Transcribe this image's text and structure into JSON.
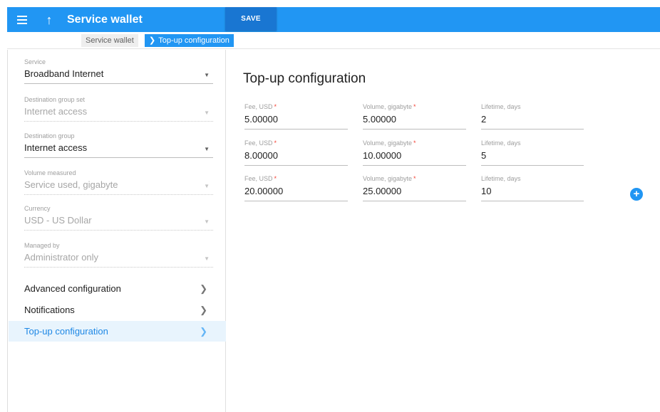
{
  "header": {
    "title": "Service wallet",
    "save_label": "SAVE"
  },
  "breadcrumb": {
    "parent": "Service wallet",
    "current": "Top-up configuration"
  },
  "sidebar": {
    "fields": [
      {
        "label": "Service",
        "value": "Broadband Internet",
        "enabled": true
      },
      {
        "label": "Destination group set",
        "value": "Internet access",
        "enabled": false
      },
      {
        "label": "Destination group",
        "value": "Internet access",
        "enabled": true
      },
      {
        "label": "Volume measured",
        "value": "Service used, gigabyte",
        "enabled": false
      },
      {
        "label": "Currency",
        "value": "USD - US Dollar",
        "enabled": false
      },
      {
        "label": "Managed by",
        "value": "Administrator only",
        "enabled": false
      }
    ],
    "nav": [
      {
        "label": "Advanced configuration",
        "active": false
      },
      {
        "label": "Notifications",
        "active": false
      },
      {
        "label": "Top-up configuration",
        "active": true
      }
    ]
  },
  "main": {
    "title": "Top-up configuration",
    "columns": {
      "fee": "Fee, USD",
      "volume": "Volume, gigabyte",
      "lifetime": "Lifetime, days"
    },
    "rows": [
      {
        "fee": "5.00000",
        "volume": "5.00000",
        "lifetime": "2"
      },
      {
        "fee": "8.00000",
        "volume": "10.00000",
        "lifetime": "5"
      },
      {
        "fee": "20.00000",
        "volume": "25.00000",
        "lifetime": "10"
      }
    ],
    "required_marker": "*",
    "add_icon": "+"
  },
  "colors": {
    "primary": "#2196f3",
    "save_button": "#1976d2",
    "required": "#f44336",
    "active_nav_bg": "#e8f4fd"
  }
}
